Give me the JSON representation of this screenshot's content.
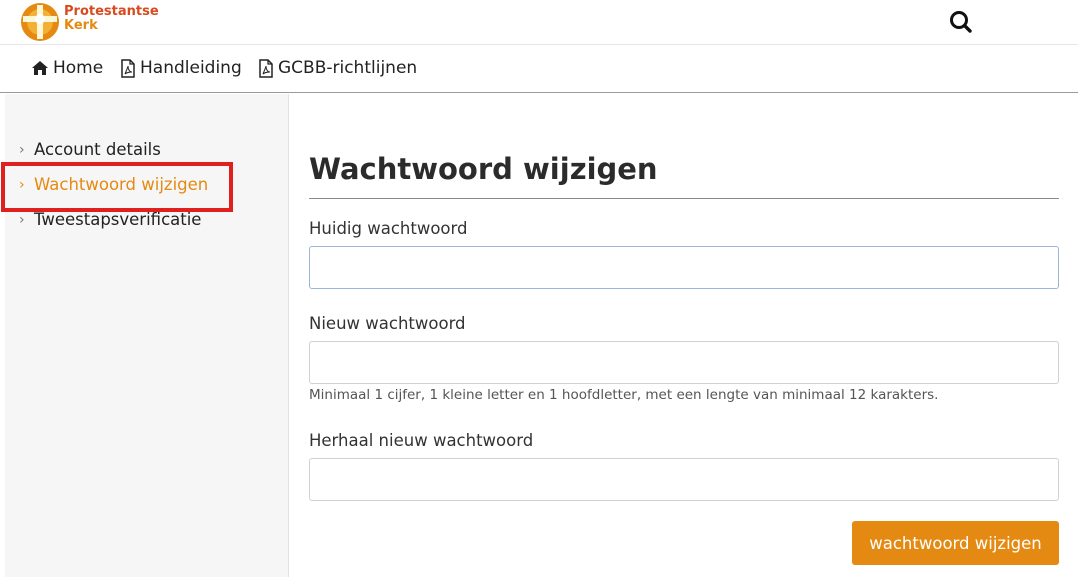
{
  "header": {
    "logo_line1": "Protestantse",
    "logo_line2": "Kerk",
    "search_icon": "search-icon"
  },
  "nav": {
    "items": [
      {
        "label": "Home",
        "icon": "home-icon"
      },
      {
        "label": "Handleiding",
        "icon": "pdf-file-icon"
      },
      {
        "label": "GCBB-richtlijnen",
        "icon": "pdf-file-icon"
      }
    ]
  },
  "sidebar": {
    "items": [
      {
        "label": "Account details",
        "active": false
      },
      {
        "label": "Wachtwoord wijzigen",
        "active": true
      },
      {
        "label": "Tweestapsverificatie",
        "active": false
      }
    ]
  },
  "main": {
    "title": "Wachtwoord wijzigen",
    "current_password_label": "Huidig wachtwoord",
    "current_password_value": "",
    "new_password_label": "Nieuw wachtwoord",
    "new_password_value": "",
    "new_password_help": "Minimaal 1 cijfer, 1 kleine letter en 1 hoofdletter, met een lengte van minimaal 12 karakters.",
    "repeat_password_label": "Herhaal nieuw wachtwoord",
    "repeat_password_value": "",
    "submit_label": "wachtwoord wijzigen"
  },
  "colors": {
    "accent": "#e48a12",
    "logo_red": "#d94a1e",
    "highlight": "#e01f1f"
  }
}
